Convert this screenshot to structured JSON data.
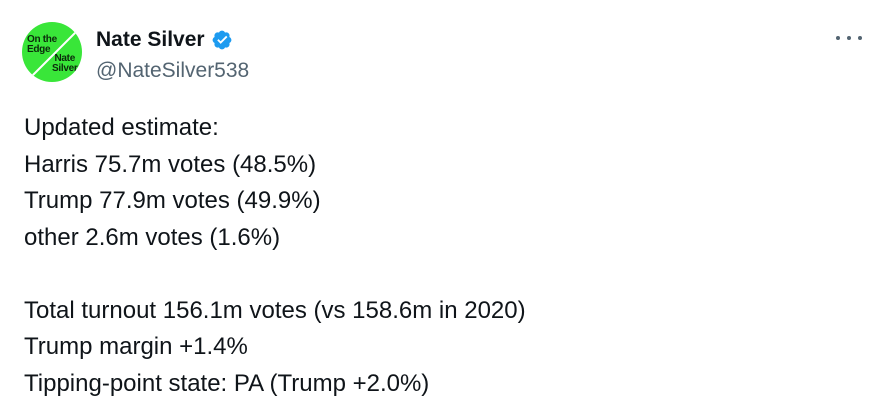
{
  "avatar": {
    "text_top": [
      "On the",
      "Edge"
    ],
    "text_bottom": [
      "Nate",
      "Silver"
    ],
    "bg_color": "#39e639"
  },
  "author": {
    "display_name": "Nate Silver",
    "handle": "@NateSilver538",
    "verified_icon": "verified-badge-icon",
    "verified_color": "#1d9bf0"
  },
  "menu": {
    "icon": "more-horizontal-icon"
  },
  "tweet": {
    "lines": [
      "Updated estimate:",
      "Harris 75.7m votes (48.5%)",
      "Trump 77.9m votes (49.9%)",
      "other 2.6m votes (1.6%)",
      "",
      "Total turnout 156.1m votes (vs 158.6m in 2020)",
      "Trump margin +1.4%",
      "Tipping-point state: PA (Trump +2.0%)"
    ]
  }
}
